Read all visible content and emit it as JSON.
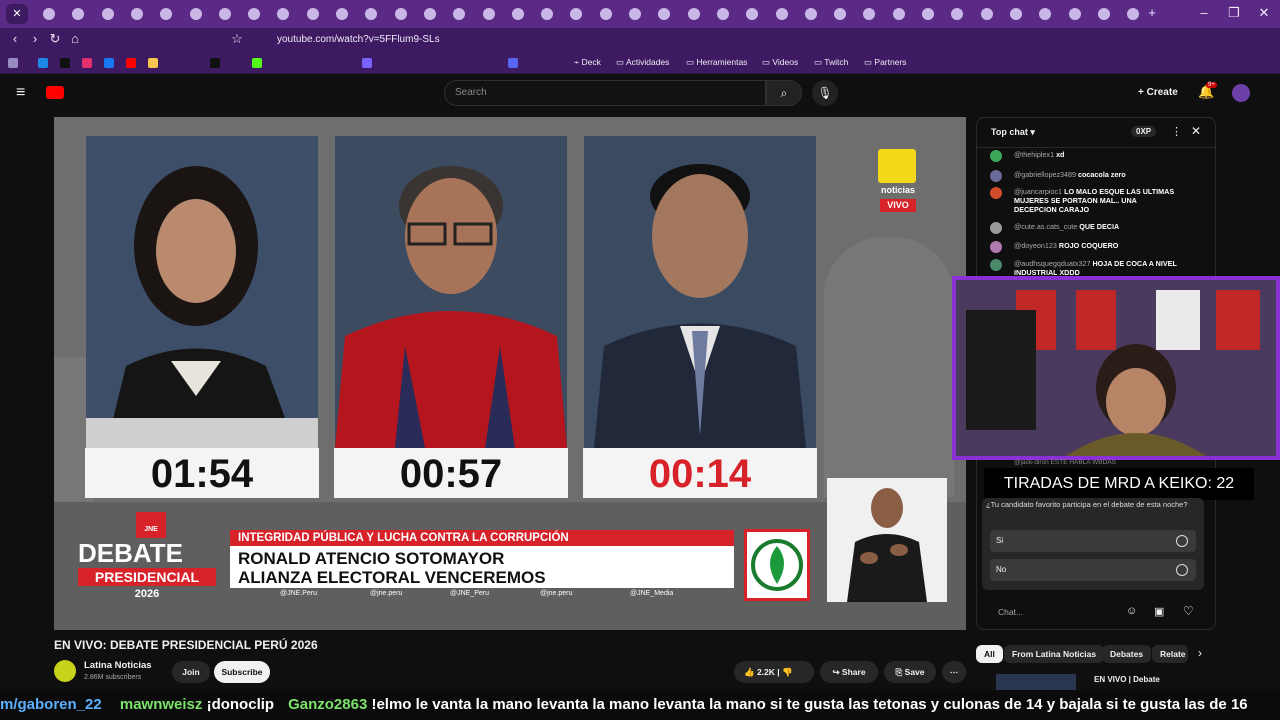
{
  "browser": {
    "url": "youtube.com/watch?v=5FFlum9-SLs",
    "bookmarks": [
      "Deck",
      "Actividades",
      "Herramientas",
      "Videos",
      "Twitch",
      "Partners"
    ]
  },
  "youtube": {
    "search_placeholder": "Search",
    "create_label": "Create",
    "notif_count": "9+"
  },
  "video": {
    "timers": [
      "01:54",
      "00:57",
      "00:14"
    ],
    "timer_colors": [
      "#111111",
      "#111111",
      "#d8222a"
    ],
    "topic": "INTEGRIDAD PÚBLICA Y LUCHA CONTRA LA CORRUPCIÓN",
    "candidate_name": "RONALD ATENCIO SOTOMAYOR",
    "party": "ALIANZA ELECTORAL VENCEREMOS",
    "debate_logo_line1": "DEBATE",
    "debate_logo_line2": "PRESIDENCIAL",
    "debate_logo_year": "2026",
    "jne": "JNE",
    "socials": [
      "@JNE.Peru",
      "@jne.peru",
      "@JNE_Peru",
      "@jne.peru",
      "@JNE_Media"
    ],
    "brand": "noticias",
    "live": "VIVO"
  },
  "below": {
    "title": "EN VIVO: DEBATE PRESIDENCIAL PERÚ 2026",
    "channel": "Latina Noticias",
    "subscribers": "2.86M subscribers",
    "join": "Join",
    "subscribe": "Subscribe",
    "likes": "2.2K",
    "share": "Share",
    "save": "Save"
  },
  "chat": {
    "header": "Top chat",
    "points": "0XP",
    "messages": [
      {
        "user": "@thehiplex1",
        "text": "xd",
        "color": "#3aa757"
      },
      {
        "user": "@gabriellopez3489",
        "text": "cocacola zero",
        "color": "#6b6b9a"
      },
      {
        "user": "@juancarpioc1",
        "text": "LO MALO ESQUE LAS ULTIMAS MUJERES SE PORTAON MAL.. UNA DECEPCION CARAJO",
        "color": "#d14a2a"
      },
      {
        "user": "@cute.as.cats_cute",
        "text": "QUE DECIA",
        "color": "#9a9a9a"
      },
      {
        "user": "@doyeon123",
        "text": "ROJO COQUERO",
        "color": "#b07ab0"
      },
      {
        "user": "@audhsquegqduatx327",
        "text": "HOJA DE COCA A NIVEL INDUSTRIAL XDDD",
        "color": "#4a8a6a"
      }
    ],
    "hidden_msg": "@jack-diron ESTE HABLA WBDAS",
    "overlay_text": "TIRADAS DE MRD A KEIKO: 22",
    "poll_question": "¿Tu candidato favorito participa en el debate de esta noche?",
    "poll_options": [
      "Si",
      "No"
    ],
    "input_placeholder": "Chat..."
  },
  "related_tabs": [
    "All",
    "From Latina Noticias",
    "Debates",
    "Relate"
  ],
  "related_first": "EN VIVO | Debate",
  "ticker": [
    {
      "user": "m/gaboren_22",
      "text": "",
      "color": "#5ab0ff"
    },
    {
      "user": "mawnweisz",
      "text": "¡donoclip",
      "color": "#7be36a"
    },
    {
      "user": "Ganzo2863",
      "text": "!elmo le vanta la mano levanta la mano levanta la mano si te gusta las tetonas y culonas de 14 y bajala si te gusta las de 16",
      "color": "#7be36a"
    }
  ]
}
